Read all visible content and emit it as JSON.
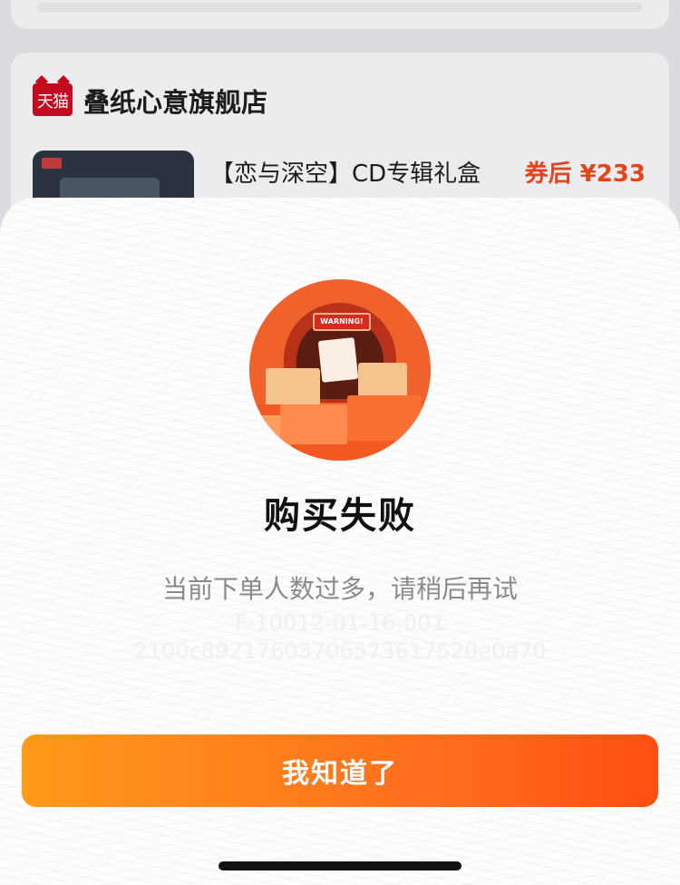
{
  "background": {
    "store": {
      "logo_text": "天猫",
      "name": "叠纸心意旗舰店"
    },
    "product": {
      "title": "【恋与深空】CD专辑礼盒",
      "price": "券后 ¥233"
    }
  },
  "dialog": {
    "illustration_sign": "WARNING!",
    "title": "购买失败",
    "message": "当前下单人数过多，请稍后再试",
    "error_code": "F-10012-01-16-001",
    "trace_id": "2100c89217603706573617520e0a70",
    "confirm_label": "我知道了"
  },
  "colors": {
    "accent_start": "#ff9a1a",
    "accent_end": "#ff4e12",
    "price": "#e2441d",
    "tmall_red": "#c40a1e"
  },
  "icons": {
    "store_logo": "tmall-icon",
    "illustration": "warning-boxes-illustration"
  }
}
